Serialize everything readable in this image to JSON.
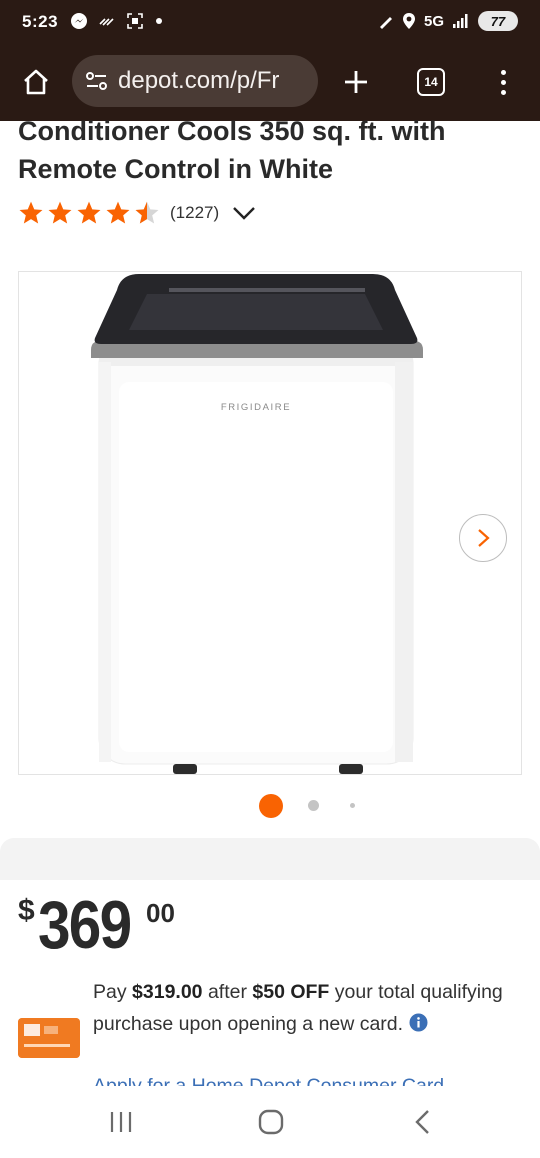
{
  "status_bar": {
    "time": "5:23",
    "network": "5G",
    "battery": "77"
  },
  "browser": {
    "url": "depot.com/p/Fr",
    "tab_count": "14"
  },
  "product": {
    "title": "Conditioner Cools 350 sq. ft. with Remote Control in White",
    "rating": 4.5,
    "review_count": "(1227)",
    "brand_on_unit": "FRIGIDAIRE",
    "image_count": 3,
    "active_image": 1
  },
  "price": {
    "currency": "$",
    "dollars": "369",
    "cents": "00"
  },
  "promo": {
    "pre": "Pay ",
    "amount": "$319.00",
    "mid": " after ",
    "discount": "$50 OFF",
    "post": " your total qualifying purchase upon opening a new card.",
    "link": "Apply for a Home Depot Consumer Card"
  },
  "colors": {
    "chrome": "#2a1a14",
    "accent": "#f96302",
    "link": "#3b6fb6"
  },
  "icons": [
    "home-icon",
    "tune-icon",
    "plus-icon",
    "tabs-icon",
    "menu-icon",
    "star-icon",
    "chevron-down-icon",
    "chevron-right-icon",
    "info-icon",
    "recents-icon",
    "home-nav-icon",
    "back-icon"
  ]
}
